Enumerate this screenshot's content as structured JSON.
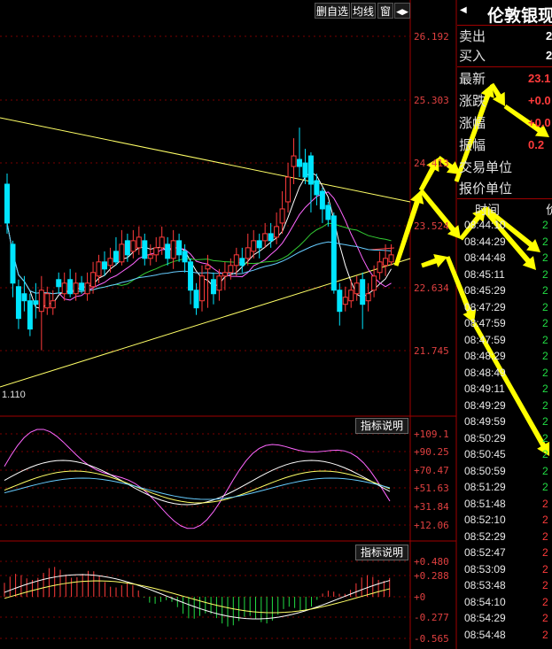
{
  "toolbar": {
    "delete_watch": "删自选",
    "ma_lines": "均线",
    "window": "窗",
    "arrow": "◀▶"
  },
  "colors": {
    "up": "#ff3b3b",
    "down": "#00e5ff",
    "grid": "#7a0000",
    "axis_text": "#e04040",
    "yellow": "#ffff66",
    "arrow": "#ffff00"
  },
  "price_axis": [
    "26.192",
    "25.303",
    "24.413",
    "23.524",
    "22.634",
    "21.745"
  ],
  "low_marker": "1.110",
  "indicator1": {
    "button": "指标说明",
    "axis": [
      "+109.1",
      "+90.25",
      "+70.47",
      "+51.63",
      "+31.84",
      "+12.06"
    ]
  },
  "indicator2": {
    "button": "指标说明",
    "axis": [
      "+0.480",
      "+0.288",
      "+0",
      "-0.277",
      "-0.565"
    ]
  },
  "quote": {
    "name": "伦敦银现",
    "sell_label": "卖出",
    "buy_label": "买入",
    "sell_val": "2",
    "buy_val": "2",
    "latest_label": "最新",
    "latest_val": "23.1",
    "change_label": "涨跌",
    "change_val": "+0.0",
    "change_pct_label": "涨幅",
    "change_pct_val": "+0.0",
    "amplitude_label": "振幅",
    "amplitude_val": "0.2",
    "trade_unit_label": "交易单位",
    "price_unit_label": "报价单位"
  },
  "trades_header": {
    "time": "时间",
    "price": "价"
  },
  "trades": [
    {
      "time": "08:44:10",
      "price": "2",
      "dir": "down"
    },
    {
      "time": "08:44:29",
      "price": "2",
      "dir": "down"
    },
    {
      "time": "08:44:48",
      "price": "2",
      "dir": "down"
    },
    {
      "time": "08:45:11",
      "price": "2",
      "dir": "down"
    },
    {
      "time": "08:45:29",
      "price": "2",
      "dir": "down"
    },
    {
      "time": "08:47:29",
      "price": "2",
      "dir": "down"
    },
    {
      "time": "08:47:59",
      "price": "2",
      "dir": "down"
    },
    {
      "time": "08:47:59",
      "price": "2",
      "dir": "down"
    },
    {
      "time": "08:48:29",
      "price": "2",
      "dir": "down"
    },
    {
      "time": "08:48:49",
      "price": "2",
      "dir": "down"
    },
    {
      "time": "08:49:11",
      "price": "2",
      "dir": "down"
    },
    {
      "time": "08:49:29",
      "price": "2",
      "dir": "down"
    },
    {
      "time": "08:49:59",
      "price": "2",
      "dir": "down"
    },
    {
      "time": "08:50:29",
      "price": "2",
      "dir": "down"
    },
    {
      "time": "08:50:45",
      "price": "2",
      "dir": "down"
    },
    {
      "time": "08:50:59",
      "price": "2",
      "dir": "down"
    },
    {
      "time": "08:51:29",
      "price": "2",
      "dir": "down"
    },
    {
      "time": "08:51:48",
      "price": "2",
      "dir": "up"
    },
    {
      "time": "08:52:10",
      "price": "2",
      "dir": "up"
    },
    {
      "time": "08:52:29",
      "price": "2",
      "dir": "up"
    },
    {
      "time": "08:52:47",
      "price": "2",
      "dir": "up"
    },
    {
      "time": "08:53:09",
      "price": "2",
      "dir": "up"
    },
    {
      "time": "08:53:48",
      "price": "2",
      "dir": "up"
    },
    {
      "time": "08:54:10",
      "price": "2",
      "dir": "up"
    },
    {
      "time": "08:54:29",
      "price": "2",
      "dir": "up"
    },
    {
      "time": "08:54:48",
      "price": "2",
      "dir": "up"
    }
  ],
  "candles": [
    [
      24.1,
      23.55,
      24.25,
      23.4
    ],
    [
      23.25,
      22.7,
      23.3,
      22.5
    ],
    [
      22.65,
      22.2,
      22.75,
      22.05
    ],
    [
      22.55,
      22.45,
      22.8,
      22.3
    ],
    [
      22.45,
      22.05,
      22.55,
      21.95
    ],
    [
      22.45,
      22.4,
      22.7,
      22.2
    ],
    [
      22.3,
      22.6,
      22.8,
      21.75
    ],
    [
      22.35,
      22.55,
      22.65,
      22.25
    ],
    [
      22.35,
      22.45,
      22.6,
      22.25
    ],
    [
      22.75,
      22.65,
      22.85,
      22.55
    ],
    [
      22.55,
      22.7,
      22.85,
      22.45
    ],
    [
      22.75,
      22.55,
      22.9,
      22.5
    ],
    [
      22.55,
      22.7,
      22.85,
      22.45
    ],
    [
      22.7,
      22.6,
      22.8,
      22.55
    ],
    [
      22.55,
      22.7,
      22.85,
      22.45
    ],
    [
      22.65,
      22.85,
      23.0,
      22.55
    ],
    [
      22.8,
      23.0,
      23.1,
      22.7
    ],
    [
      23.0,
      22.9,
      23.15,
      22.8
    ],
    [
      22.95,
      23.05,
      23.2,
      22.85
    ],
    [
      23.15,
      23.0,
      23.35,
      22.95
    ],
    [
      23.0,
      23.25,
      23.45,
      22.95
    ],
    [
      23.3,
      23.1,
      23.4,
      23.0
    ],
    [
      23.15,
      23.3,
      23.45,
      23.05
    ],
    [
      23.2,
      23.35,
      23.5,
      23.1
    ],
    [
      23.3,
      23.05,
      23.4,
      22.95
    ],
    [
      23.05,
      23.1,
      23.25,
      22.95
    ],
    [
      23.1,
      23.2,
      23.35,
      23.0
    ],
    [
      23.2,
      23.35,
      23.5,
      23.1
    ],
    [
      23.25,
      23.05,
      23.35,
      22.95
    ],
    [
      23.05,
      23.3,
      23.45,
      22.9
    ],
    [
      23.3,
      23.1,
      23.4,
      23.0
    ],
    [
      23.15,
      23.0,
      23.25,
      22.85
    ],
    [
      23.0,
      22.6,
      23.05,
      22.4
    ],
    [
      22.6,
      22.35,
      22.7,
      22.25
    ],
    [
      22.45,
      22.8,
      22.95,
      22.3
    ],
    [
      22.9,
      22.95,
      23.1,
      22.35
    ],
    [
      22.75,
      22.55,
      22.85,
      22.4
    ],
    [
      22.6,
      22.8,
      22.9,
      22.45
    ],
    [
      22.8,
      22.85,
      23.0,
      22.6
    ],
    [
      22.85,
      22.95,
      23.05,
      22.75
    ],
    [
      22.95,
      23.1,
      23.2,
      22.8
    ],
    [
      23.05,
      22.95,
      23.2,
      22.85
    ],
    [
      23.05,
      23.2,
      23.4,
      22.95
    ],
    [
      23.15,
      23.3,
      23.45,
      23.05
    ],
    [
      23.3,
      23.2,
      23.4,
      23.05
    ],
    [
      23.3,
      23.4,
      23.55,
      23.2
    ],
    [
      23.4,
      23.3,
      23.55,
      23.2
    ],
    [
      23.35,
      23.5,
      23.7,
      23.25
    ],
    [
      23.55,
      23.75,
      24.0,
      23.4
    ],
    [
      23.85,
      24.2,
      24.4,
      23.7
    ],
    [
      24.35,
      24.5,
      24.75,
      24.1
    ],
    [
      24.45,
      24.35,
      24.9,
      24.2
    ],
    [
      24.4,
      24.2,
      24.6,
      24.1
    ],
    [
      24.5,
      24.1,
      24.55,
      23.7
    ],
    [
      24.15,
      23.95,
      24.25,
      23.8
    ],
    [
      24.0,
      23.75,
      24.05,
      23.55
    ],
    [
      23.8,
      23.6,
      23.85,
      23.5
    ],
    [
      23.65,
      22.6,
      23.7,
      22.55
    ],
    [
      22.6,
      22.3,
      22.7,
      22.1
    ],
    [
      22.4,
      22.5,
      22.65,
      22.3
    ],
    [
      22.45,
      22.6,
      22.75,
      22.35
    ],
    [
      22.55,
      22.7,
      22.8,
      22.45
    ],
    [
      22.75,
      22.4,
      22.85,
      22.05
    ],
    [
      22.45,
      22.55,
      22.7,
      22.3
    ],
    [
      22.6,
      22.8,
      22.95,
      22.5
    ],
    [
      22.85,
      23.0,
      23.15,
      22.75
    ],
    [
      22.95,
      23.05,
      23.25,
      22.8
    ],
    [
      23.0,
      23.1,
      23.25,
      22.95
    ]
  ]
}
